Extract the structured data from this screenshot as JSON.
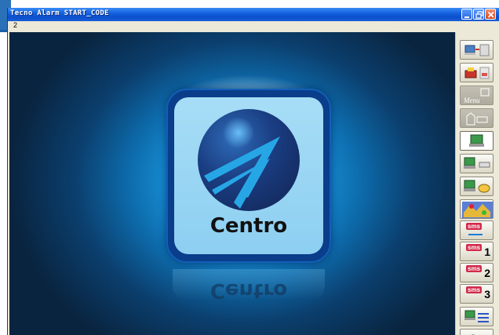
{
  "window": {
    "title": "Tecno Alarm  START_CODE",
    "controls": [
      "minimize-icon",
      "maximize-icon",
      "close-icon"
    ]
  },
  "menu": {
    "items": [
      {
        "label": "2"
      }
    ]
  },
  "main": {
    "app_icon": {
      "label": "Centro",
      "reflection_label": "Centro",
      "icon": "centro-logo-icon"
    }
  },
  "sidebar": {
    "buttons": [
      {
        "icon": "computer-transfer-icon",
        "enabled": true
      },
      {
        "icon": "printer-document-icon",
        "enabled": true
      },
      {
        "icon": "menu-icon",
        "label": "Menu",
        "enabled": false
      },
      {
        "icon": "door-key-icon",
        "enabled": false
      },
      {
        "icon": "computer-icon",
        "enabled": true,
        "pressed": true
      },
      {
        "icon": "computer-network-icon",
        "enabled": true
      },
      {
        "icon": "computer-database-icon",
        "enabled": true
      },
      {
        "icon": "map-icon",
        "enabled": true
      },
      {
        "icon": "sms-icon",
        "label": "sms",
        "enabled": true
      },
      {
        "icon": "sms-1-icon",
        "label": "sms",
        "number": "1",
        "enabled": true
      },
      {
        "icon": "sms-2-icon",
        "label": "sms",
        "number": "2",
        "enabled": true
      },
      {
        "icon": "sms-3-icon",
        "label": "sms",
        "number": "3",
        "enabled": true
      },
      {
        "icon": "computer-users-icon",
        "enabled": true
      },
      {
        "icon": "key-icon",
        "enabled": true
      }
    ]
  },
  "colors": {
    "titlebar": "#0b4fcc",
    "background_center": "#3ec3ff",
    "background_edge": "#09243f",
    "icon_border": "#0a3d8a",
    "icon_fill": "#a7ddf6"
  }
}
